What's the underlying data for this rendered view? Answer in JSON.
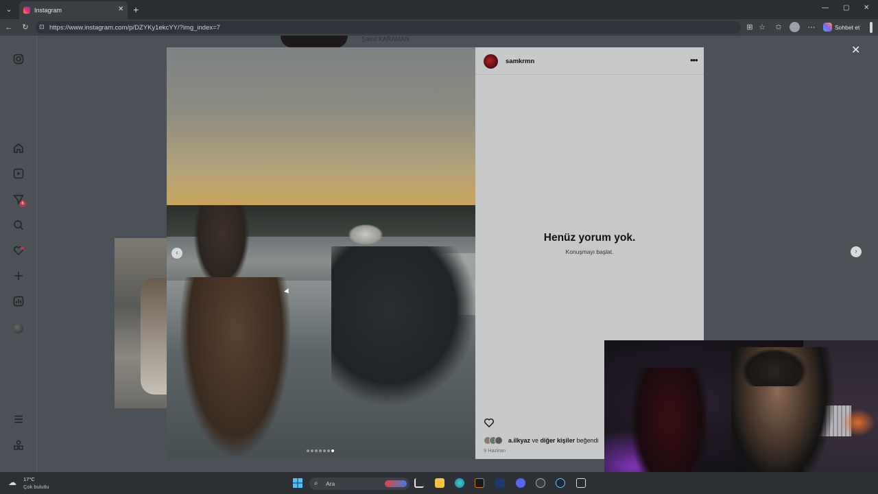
{
  "browser": {
    "tab_title": "Instagram",
    "new_tab": "+",
    "url": "https://www.instagram.com/p/DZYKy1ekcYY/?img_index=7",
    "copilot_label": "Sohbet et",
    "window_controls": {
      "minimize": "—",
      "maximize": "▢",
      "close": "✕"
    }
  },
  "feed": {
    "top_name": "Şamil KARAMAN"
  },
  "post": {
    "username": "samkrmn",
    "more": "•••",
    "empty_title": "Henüz yorum yok.",
    "empty_sub": "Konuşmayı başlat.",
    "liked_by_user": "a.ilkyaz",
    "liked_connector": " ve ",
    "liked_others": "diğer kişiler",
    "liked_suffix": " beğendi",
    "date": "9 Haziran",
    "carousel_count": 7,
    "carousel_active_index": 7,
    "close": "✕",
    "prev_arrow": "‹",
    "next_arrow": "›"
  },
  "sidebar": {
    "items": [
      {
        "icon": "instagram-logo-icon"
      },
      {
        "icon": "home-icon"
      },
      {
        "icon": "reels-icon"
      },
      {
        "icon": "messages-icon",
        "badge": "6"
      },
      {
        "icon": "search-icon"
      },
      {
        "icon": "notifications-icon"
      },
      {
        "icon": "create-icon"
      },
      {
        "icon": "insights-icon"
      },
      {
        "icon": "profile-icon"
      },
      {
        "icon": "more-menu-icon"
      },
      {
        "icon": "also-from-meta-icon"
      }
    ]
  },
  "taskbar": {
    "temperature": "17°C",
    "weather": "Çok bulutlu",
    "search_placeholder": "Ara"
  },
  "colors": {
    "page_overlay": "#4b5157",
    "panel_bg": "#c6c8c9",
    "taskbar_bg": "#2d3136",
    "badge_red": "#e0245e"
  }
}
